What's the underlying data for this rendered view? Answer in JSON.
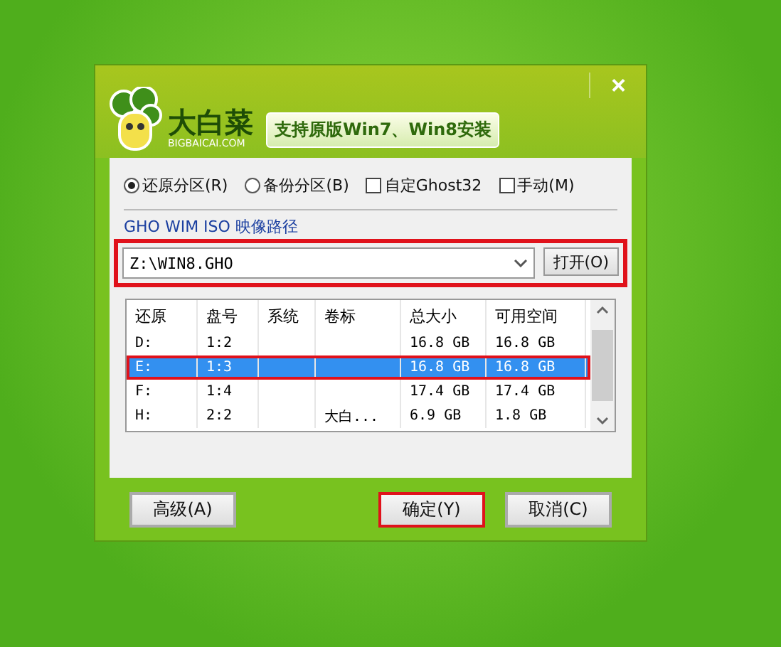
{
  "window": {
    "logo_text": "大白菜",
    "logo_site": "BIGBAICAI.COM",
    "slogan": "支持原版Win7、Win8安装",
    "close": "×"
  },
  "modes": [
    {
      "kind": "radio",
      "label": "还原分区(R)",
      "selected": true
    },
    {
      "kind": "radio",
      "label": "备份分区(B)",
      "selected": false
    },
    {
      "kind": "checkbox",
      "label": "自定Ghost32",
      "checked": false
    },
    {
      "kind": "checkbox",
      "label": "手动(M)",
      "checked": false
    }
  ],
  "path": {
    "label": "GHO WIM ISO 映像路径",
    "value": "Z:\\WIN8.GHO",
    "open_button": "打开(O)",
    "highlighted": true
  },
  "table": {
    "columns": [
      "还原",
      "盘号",
      "系统",
      "卷标",
      "总大小",
      "可用空间"
    ],
    "rows": [
      {
        "cells": [
          "D:",
          "1:2",
          "",
          "",
          "16.8 GB",
          "16.8 GB"
        ],
        "selected": false,
        "highlighted": false
      },
      {
        "cells": [
          "E:",
          "1:3",
          "",
          "",
          "16.8 GB",
          "16.8 GB"
        ],
        "selected": true,
        "highlighted": true
      },
      {
        "cells": [
          "F:",
          "1:4",
          "",
          "",
          "17.4 GB",
          "17.4 GB"
        ],
        "selected": false,
        "highlighted": false
      },
      {
        "cells": [
          "H:",
          "2:2",
          "",
          "大白...",
          "6.9 GB",
          "1.8 GB"
        ],
        "selected": false,
        "highlighted": false
      }
    ]
  },
  "buttons": [
    {
      "label": "高级(A)",
      "highlighted": false
    },
    {
      "label": "确定(Y)",
      "highlighted": true
    },
    {
      "label": "取消(C)",
      "highlighted": false
    }
  ]
}
